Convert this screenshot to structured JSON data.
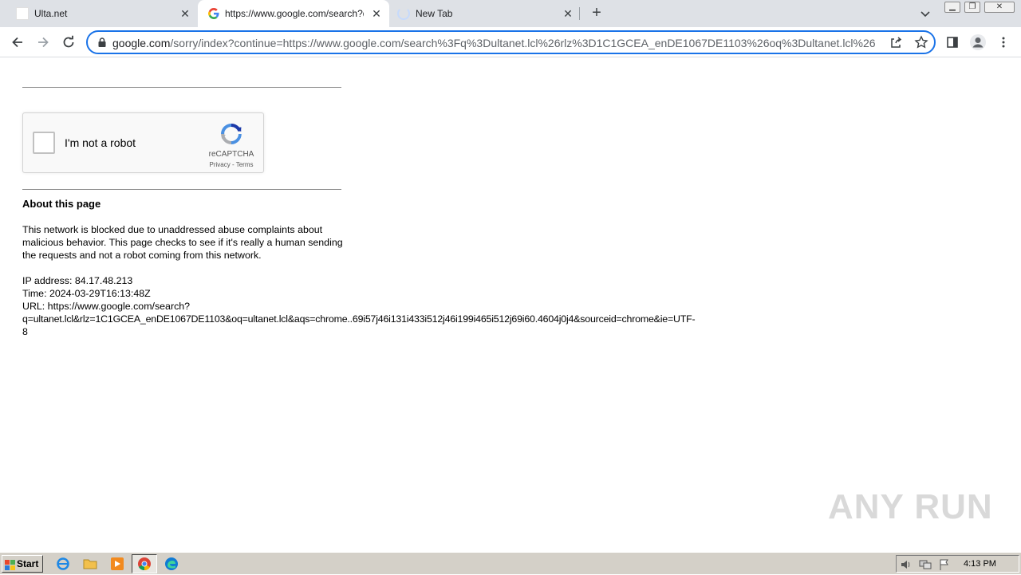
{
  "browser": {
    "tabs": [
      {
        "title": "Ulta.net",
        "active": false
      },
      {
        "title": "https://www.google.com/search?q=",
        "active": true
      },
      {
        "title": "New Tab",
        "active": false
      }
    ],
    "url_host": "google.com",
    "url_path": "/sorry/index?continue=https://www.google.com/search%3Fq%3Dultanet.lcl%26rlz%3D1C1GCEA_enDE1067DE1103%26oq%3Dultanet.lcl%26",
    "accent": "#1a73e8"
  },
  "captcha": {
    "label": "I'm not a robot",
    "brand": "reCAPTCHA",
    "privacy": "Privacy",
    "separator": " - ",
    "terms": "Terms"
  },
  "about": {
    "heading": "About this page",
    "paragraph": "This network is blocked due to unaddressed abuse complaints about malicious behavior. This page checks to see if it's really a human sending the requests and not a robot coming from this network.",
    "ip_line": "IP address: 84.17.48.213",
    "time_line": "Time: 2024-03-29T16:13:48Z",
    "url_line1": "URL: https://www.google.com/search?",
    "url_line2": "q=ultanet.lcl&rlz=1C1GCEA_enDE1067DE1103&oq=ultanet.lcl&aqs=chrome..69i57j46i131i433i512j46i199i465i512j69i60.4604j0j4&sourceid=chrome&ie=UTF-",
    "url_line3": "8"
  },
  "watermark": "ANY RUN",
  "taskbar": {
    "start_label": "Start",
    "clock": "4:13 PM"
  }
}
